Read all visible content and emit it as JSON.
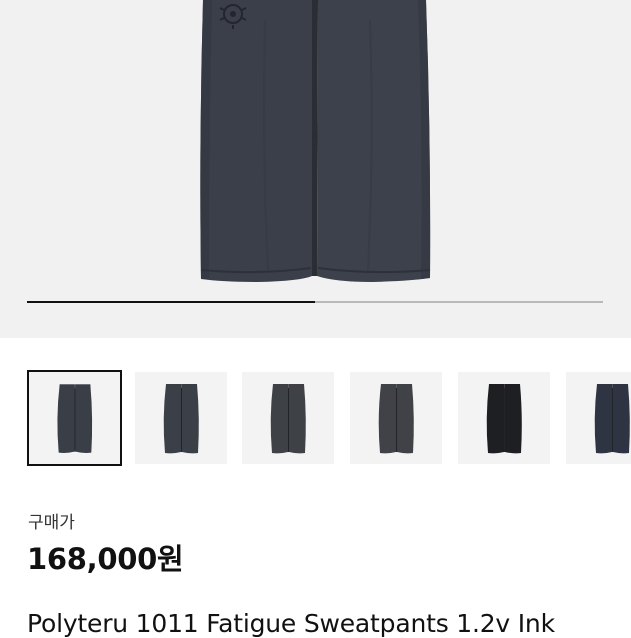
{
  "product": {
    "purchase_label": "구매가",
    "price": "168,000원",
    "title": "Polyteru 1011 Fatigue Sweatpants 1.2v Ink"
  },
  "gallery": {
    "progress_fraction": 0.5,
    "selected_index": 0,
    "thumbnails": [
      {
        "name": "thumbnail-1",
        "pants_color": "#3a3e47"
      },
      {
        "name": "thumbnail-2",
        "pants_color": "#3b3f47"
      },
      {
        "name": "thumbnail-3",
        "pants_color": "#3e4146"
      },
      {
        "name": "thumbnail-4",
        "pants_color": "#404247"
      },
      {
        "name": "thumbnail-5",
        "pants_color": "#1e1f22"
      },
      {
        "name": "thumbnail-6",
        "pants_color": "#2f3442"
      }
    ]
  },
  "colors": {
    "hero_background": "#f1f1f1",
    "pants_main": "#3b3f49",
    "progress_track": "#b9b9b9",
    "progress_fill": "#111111"
  }
}
